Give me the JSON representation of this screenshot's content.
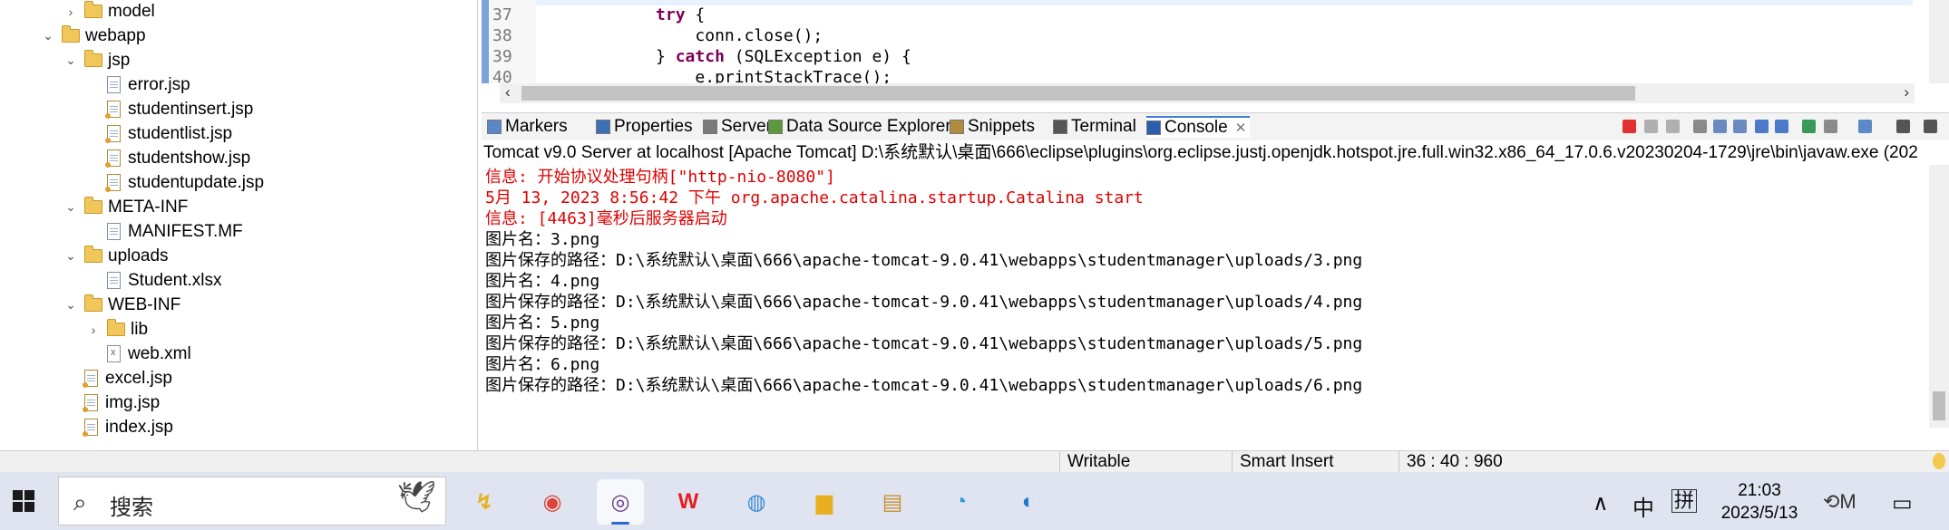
{
  "tree": {
    "items": [
      {
        "label": "model",
        "type": "folder",
        "toggle": "collapsed",
        "indent": 1
      },
      {
        "label": "webapp",
        "type": "folder",
        "toggle": "expanded",
        "indent": 0
      },
      {
        "label": "jsp",
        "type": "folder",
        "toggle": "expanded",
        "indent": 1
      },
      {
        "label": "error.jsp",
        "type": "file",
        "toggle": "none",
        "indent": 2
      },
      {
        "label": "studentinsert.jsp",
        "type": "jsp",
        "toggle": "none",
        "indent": 2
      },
      {
        "label": "studentlist.jsp",
        "type": "jsp",
        "toggle": "none",
        "indent": 2
      },
      {
        "label": "studentshow.jsp",
        "type": "jsp",
        "toggle": "none",
        "indent": 2
      },
      {
        "label": "studentupdate.jsp",
        "type": "jsp",
        "toggle": "none",
        "indent": 2
      },
      {
        "label": "META-INF",
        "type": "folder",
        "toggle": "expanded",
        "indent": 1
      },
      {
        "label": "MANIFEST.MF",
        "type": "file",
        "toggle": "none",
        "indent": 2
      },
      {
        "label": "uploads",
        "type": "folder",
        "toggle": "expanded",
        "indent": 1
      },
      {
        "label": "Student.xlsx",
        "type": "file",
        "toggle": "none",
        "indent": 2
      },
      {
        "label": "WEB-INF",
        "type": "folder",
        "toggle": "expanded",
        "indent": 1
      },
      {
        "label": "lib",
        "type": "folder",
        "toggle": "collapsed",
        "indent": 2
      },
      {
        "label": "web.xml",
        "type": "xml",
        "toggle": "none",
        "indent": 2
      },
      {
        "label": "excel.jsp",
        "type": "jsp",
        "toggle": "none",
        "indent": 1
      },
      {
        "label": "img.jsp",
        "type": "jsp",
        "toggle": "none",
        "indent": 1
      },
      {
        "label": "index.jsp",
        "type": "jsp",
        "toggle": "none",
        "indent": 1
      }
    ]
  },
  "editor": {
    "lines": [
      {
        "num": "37",
        "pre": "            ",
        "kw": "try",
        "post": " {"
      },
      {
        "num": "38",
        "pre": "                conn.close();",
        "kw": "",
        "post": ""
      },
      {
        "num": "39",
        "pre": "            } ",
        "kw": "catch",
        "post": " (SQLException e) {"
      },
      {
        "num": "40",
        "pre": "                e.printStackTrace();",
        "kw": "",
        "post": ""
      }
    ]
  },
  "views": {
    "tabs": [
      {
        "label": "Markers",
        "icon": "markers-icon",
        "color": "#5a86c8"
      },
      {
        "label": "Properties",
        "icon": "properties-icon",
        "color": "#3b6fb6"
      },
      {
        "label": "Servers",
        "icon": "servers-icon",
        "color": "#7a7a7a"
      },
      {
        "label": "Data Source Explorer",
        "icon": "data-source-icon",
        "color": "#5a9a3a"
      },
      {
        "label": "Snippets",
        "icon": "snippets-icon",
        "color": "#b08a3e"
      },
      {
        "label": "Terminal",
        "icon": "terminal-icon",
        "color": "#555555"
      },
      {
        "label": "Console",
        "icon": "console-icon",
        "color": "#2b5fae",
        "active": true
      }
    ],
    "close_glyph": "✕",
    "console_header": "Tomcat v9.0 Server at localhost [Apache Tomcat] D:\\系统默认\\桌面\\666\\eclipse\\plugins\\org.eclipse.justj.openjdk.hotspot.jre.full.win32.x86_64_17.0.6.v20230204-1729\\jre\\bin\\javaw.exe  (202",
    "output": [
      {
        "text": "信息: 开始协议处理句柄[\"http-nio-8080\"]",
        "err": true
      },
      {
        "text": "5月 13, 2023 8:56:42 下午 org.apache.catalina.startup.Catalina start",
        "err": true
      },
      {
        "text": "信息: [4463]毫秒后服务器启动",
        "err": true
      },
      {
        "text": "图片名：3.png",
        "err": false
      },
      {
        "text": "图片保存的路径：D:\\系统默认\\桌面\\666\\apache-tomcat-9.0.41\\webapps\\studentmanager\\uploads/3.png",
        "err": false
      },
      {
        "text": "图片名：4.png",
        "err": false
      },
      {
        "text": "图片保存的路径：D:\\系统默认\\桌面\\666\\apache-tomcat-9.0.41\\webapps\\studentmanager\\uploads/4.png",
        "err": false
      },
      {
        "text": "图片名：5.png",
        "err": false
      },
      {
        "text": "图片保存的路径：D:\\系统默认\\桌面\\666\\apache-tomcat-9.0.41\\webapps\\studentmanager\\uploads/5.png",
        "err": false
      },
      {
        "text": "图片名：6.png",
        "err": false
      },
      {
        "text": "图片保存的路径：D:\\系统默认\\桌面\\666\\apache-tomcat-9.0.41\\webapps\\studentmanager\\uploads/6.png",
        "err": false
      }
    ]
  },
  "status": {
    "writable": "Writable",
    "insert_mode": "Smart Insert",
    "position": "36 : 40 : 960"
  },
  "taskbar": {
    "search_placeholder": "搜索",
    "apps": [
      {
        "name": "file-manager-app",
        "glyph": "↯",
        "color": "#e8b020"
      },
      {
        "name": "chrome-app",
        "glyph": "◉",
        "color": "#db4437"
      },
      {
        "name": "eclipse-app",
        "glyph": "◎",
        "color": "#6a3a8a",
        "active": true
      },
      {
        "name": "wps-app",
        "glyph": "W",
        "color": "#e02020"
      },
      {
        "name": "paint-app",
        "glyph": "◍",
        "color": "#3a8ad8"
      },
      {
        "name": "explorer-app",
        "glyph": "▆",
        "color": "#e8b020"
      },
      {
        "name": "winrar-app",
        "glyph": "▤",
        "color": "#c89030"
      },
      {
        "name": "chat-app",
        "glyph": "◔",
        "color": "#2a9ad8"
      },
      {
        "name": "edge-app",
        "glyph": "◐",
        "color": "#1a7ad0"
      }
    ],
    "tray": {
      "chevron": "∧",
      "ime_lang": "中",
      "ime_mode": "拼",
      "time": "21:03",
      "date": "2023/5/13"
    }
  }
}
